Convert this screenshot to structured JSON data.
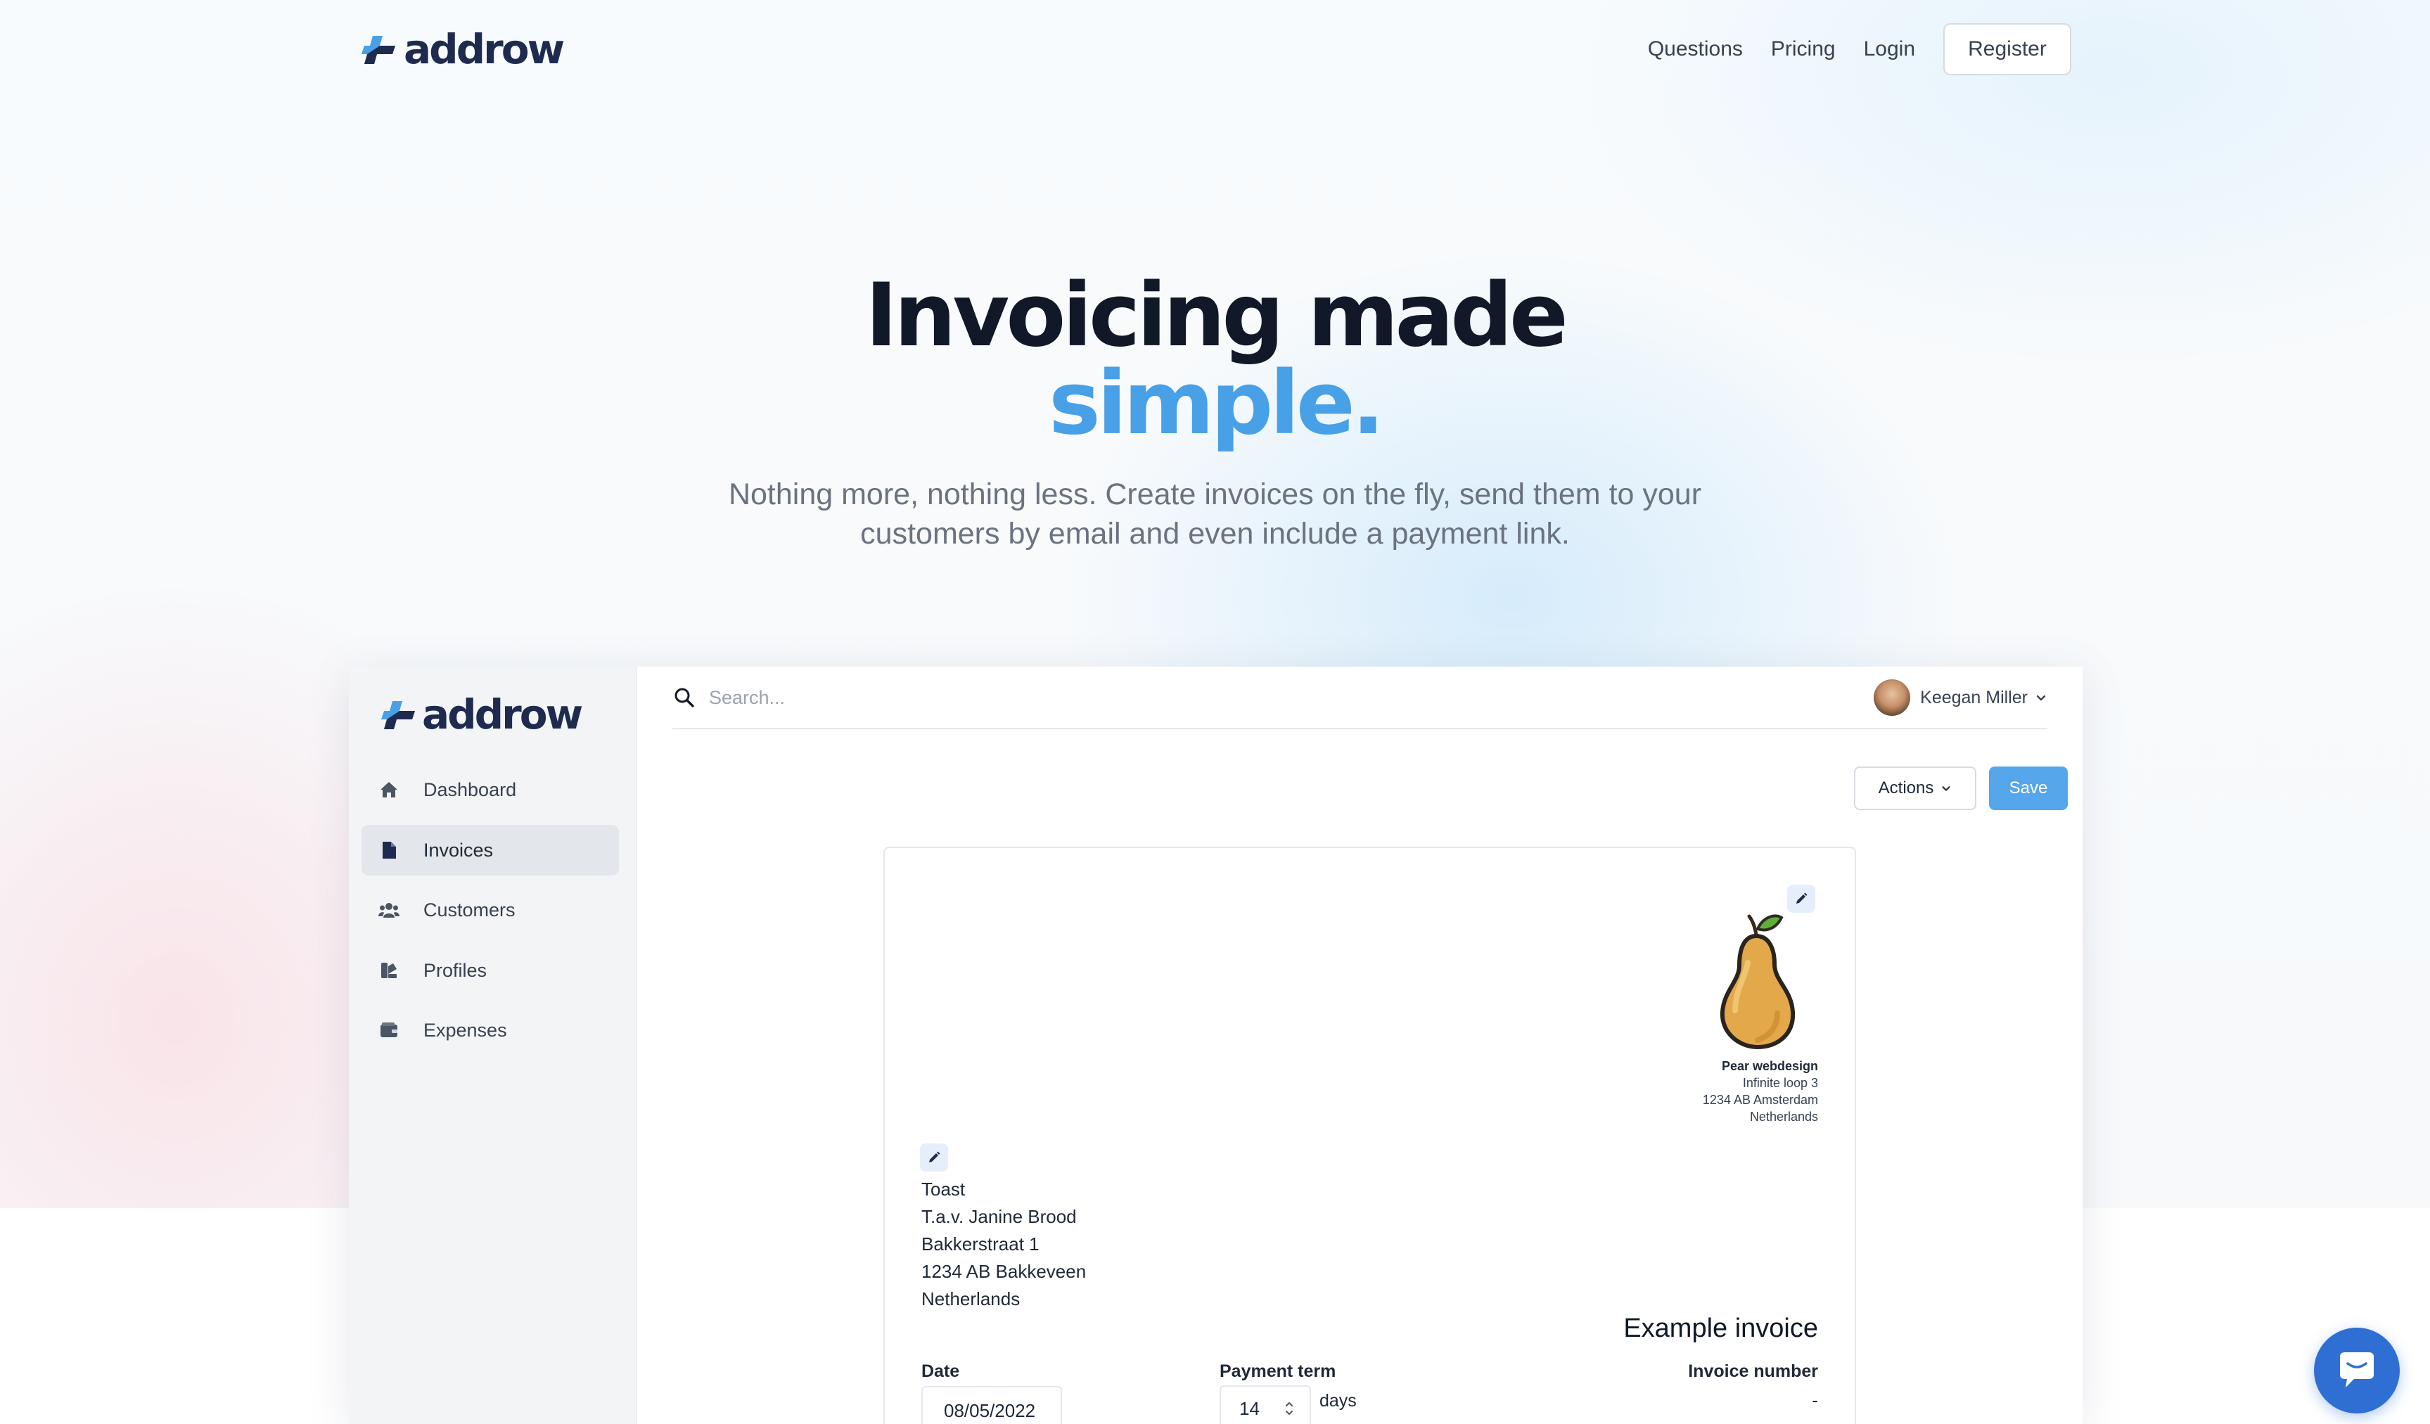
{
  "brand": {
    "name": "addrow",
    "accent": "#48a0e6",
    "dark": "#1e2b4f"
  },
  "nav": {
    "links": [
      "Questions",
      "Pricing",
      "Login"
    ],
    "register_label": "Register"
  },
  "hero": {
    "title": "Invoicing made",
    "accent": "simple.",
    "subtitle": "Nothing more, nothing less. Create invoices on the fly, send them to your customers by email and even include a payment link."
  },
  "app": {
    "sidebar": {
      "items": [
        {
          "label": "Dashboard",
          "icon": "home-icon",
          "active": false
        },
        {
          "label": "Invoices",
          "icon": "document-icon",
          "active": true
        },
        {
          "label": "Customers",
          "icon": "users-icon",
          "active": false
        },
        {
          "label": "Profiles",
          "icon": "profiles-icon",
          "active": false
        },
        {
          "label": "Expenses",
          "icon": "wallet-icon",
          "active": false
        }
      ]
    },
    "search": {
      "placeholder": "Search..."
    },
    "user": {
      "name": "Keegan Miller"
    },
    "toolbar": {
      "actions_label": "Actions",
      "save_label": "Save"
    },
    "invoice": {
      "sender": {
        "company": "Pear webdesign",
        "line1": "Infinite loop 3",
        "line2": "1234 AB Amsterdam",
        "line3": "Netherlands"
      },
      "recipient": {
        "line1": "Toast",
        "line2": "T.a.v. Janine Brood",
        "line3": "Bakkerstraat 1",
        "line4": "1234 AB Bakkeveen",
        "line5": "Netherlands"
      },
      "title": "Example invoice",
      "date_label": "Date",
      "date_value": "08/05/2022",
      "payment_term_label": "Payment term",
      "payment_term_value": "14",
      "payment_term_unit": "days",
      "invoice_number_label": "Invoice number",
      "invoice_number_value": "-"
    }
  }
}
